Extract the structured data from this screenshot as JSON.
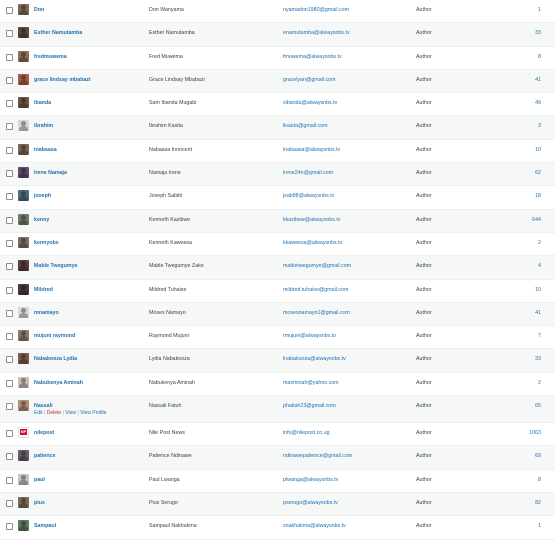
{
  "row_actions": {
    "edit": "Edit",
    "delete": "Delete",
    "view": "View",
    "view_profile": "View Profile",
    "separator": "|"
  },
  "users": [
    {
      "username": "Don",
      "name": "Don Wanyama",
      "email": "nyamadon1980@gmail.com",
      "role": "Author",
      "posts": "1",
      "avatar_color": "#7a6a58"
    },
    {
      "username": "Esther Namutamba",
      "name": "Esther Namutamba",
      "email": "enamutamba@alwaysnbs.tv",
      "role": "Author",
      "posts": "33",
      "avatar_color": "#5b4a3a"
    },
    {
      "username": "fredmuwema",
      "name": "Fred Muwema",
      "email": "fmuwema@alwaysnbs.tv",
      "role": "Author",
      "posts": "8",
      "avatar_color": "#8a6f5a"
    },
    {
      "username": "grace lindsay mbabazi",
      "name": "Grace Lindsay Mbabazi",
      "email": "gracelyan@gmail.com",
      "role": "Author",
      "posts": "41",
      "avatar_color": "#a65b4a"
    },
    {
      "username": "ibanda",
      "name": "Sam Ibanda Mugabi",
      "email": "sibanda@alwaysnbs.tv",
      "role": "Author",
      "posts": "49",
      "avatar_color": "#6a5446"
    },
    {
      "username": "ibrahim",
      "name": "Ibrahim Kasita",
      "email": "ikasita@gmail.com",
      "role": "Author",
      "posts": "3",
      "avatar_color": null
    },
    {
      "username": "inabaasa",
      "name": "Nabaasa Innocent",
      "email": "inabaasa@alwaysnbs.tv",
      "role": "Author",
      "posts": "10",
      "avatar_color": "#7c6452"
    },
    {
      "username": "Irene Namaja",
      "name": "Namaja Irene",
      "email": "irene24n@gmail.com",
      "role": "Author",
      "posts": "62",
      "avatar_color": "#5c4d6a"
    },
    {
      "username": "joseph",
      "name": "Joseph Sabiiti",
      "email": "jsab88@alwaysnbs.tv",
      "role": "Author",
      "posts": "18",
      "avatar_color": "#4f6a7a"
    },
    {
      "username": "kenny",
      "name": "Kenneth Kazibwe",
      "email": "kkazibwe@alwaysnbs.tv",
      "role": "Author",
      "posts": "644",
      "avatar_color": "#6e7b6a"
    },
    {
      "username": "kennyobs",
      "name": "Kenneth Kaweesa",
      "email": "kkaweesa@alwaysnbs.tv",
      "role": "Author",
      "posts": "2",
      "avatar_color": "#7a6f60"
    },
    {
      "username": "Mable Twegumye",
      "name": "Mable Twegumye Zake",
      "email": "mabletwegumye@gmail.com",
      "role": "Author",
      "posts": "4",
      "avatar_color": "#5a3e3a"
    },
    {
      "username": "Mildred",
      "name": "Mildred Tuhaise",
      "email": "mildred.tuhaise@gmail.com",
      "role": "Author",
      "posts": "10",
      "avatar_color": "#4a3a36"
    },
    {
      "username": "mnamayo",
      "name": "Moses Namayo",
      "email": "mosesnamayo1@gmail.com",
      "role": "Author",
      "posts": "41",
      "avatar_color": null
    },
    {
      "username": "mujuni raymond",
      "name": "Raymond Mujuni",
      "email": "rmujuni@alwaysnbs.tv",
      "role": "Author",
      "posts": "7",
      "avatar_color": "#8a7a6a"
    },
    {
      "username": "Nabakooza Lydia",
      "name": "Lydia Nabakooza",
      "email": "lnabakooza@alwaysnbs.tv",
      "role": "Author",
      "posts": "33",
      "avatar_color": "#7a5a50"
    },
    {
      "username": "Nabukenya Aminah",
      "name": "Nabukenya Aminah",
      "email": "maxminah@yahoo.com",
      "role": "Author",
      "posts": "2",
      "avatar_color": "#c9bfb6"
    },
    {
      "username": "Nassali",
      "name": "Nassali Fatuh",
      "email": "phatiah23@gmail.com",
      "role": "Author",
      "posts": "65",
      "avatar_color": "#b08f7a",
      "show_actions": true
    },
    {
      "username": "nilepost",
      "name": "Nile Post News",
      "email": "info@nilepost.co.ug",
      "role": "Author",
      "posts": "1063",
      "avatar_color": "logo",
      "logo_text": "NP"
    },
    {
      "username": "patience",
      "name": "Patience Ndinawe",
      "email": "ndinawepatience@gmail.com",
      "role": "Author",
      "posts": "69",
      "avatar_color": "#6a5a6e"
    },
    {
      "username": "paul",
      "name": "Paul Lwanga",
      "email": "plwanga@alwaysnbs.tv",
      "role": "Author",
      "posts": "8",
      "avatar_color": "#c7c2bd"
    },
    {
      "username": "pius",
      "name": "Pius Serugo",
      "email": "pserugo@alwaysnbs.tv",
      "role": "Author",
      "posts": "82",
      "avatar_color": "#7c6a58"
    },
    {
      "username": "Sampaul",
      "name": "Sampaul Nakhakma",
      "email": "snakhakma@alwaysnbs.tv",
      "role": "Author",
      "posts": "1",
      "avatar_color": "#5e7a5a"
    }
  ]
}
